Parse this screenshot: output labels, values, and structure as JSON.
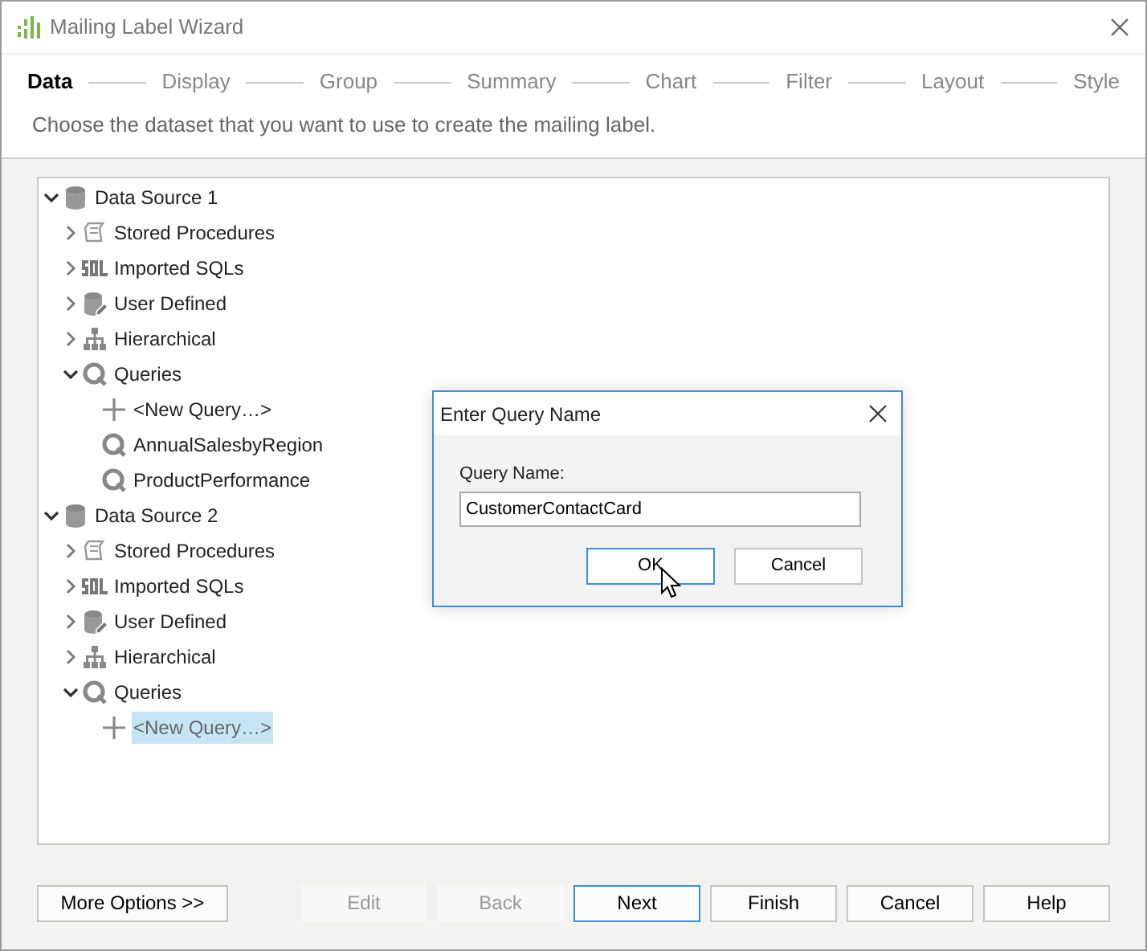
{
  "window": {
    "title": "Mailing Label Wizard"
  },
  "steps": [
    {
      "label": "Data",
      "selected": true
    },
    {
      "label": "Display",
      "selected": false
    },
    {
      "label": "Group",
      "selected": false
    },
    {
      "label": "Summary",
      "selected": false
    },
    {
      "label": "Chart",
      "selected": false
    },
    {
      "label": "Filter",
      "selected": false
    },
    {
      "label": "Layout",
      "selected": false
    },
    {
      "label": "Style",
      "selected": false
    }
  ],
  "instruction": "Choose the dataset that you want to use to create the mailing label.",
  "tree": [
    {
      "kind": "datasource",
      "label": "Data Source 1",
      "expanded": true,
      "selected": false,
      "children": [
        {
          "kind": "procedures",
          "label": "Stored Procedures",
          "expanded": false,
          "selected": false
        },
        {
          "kind": "sql",
          "label": "Imported SQLs",
          "expanded": false,
          "selected": false
        },
        {
          "kind": "userdefined",
          "label": "User Defined",
          "expanded": false,
          "selected": false
        },
        {
          "kind": "hierarchical",
          "label": "Hierarchical",
          "expanded": false,
          "selected": false
        },
        {
          "kind": "queries",
          "label": "Queries",
          "expanded": true,
          "selected": false,
          "children": [
            {
              "kind": "new",
              "label": "<New Query…>",
              "selected": false
            },
            {
              "kind": "query",
              "label": "AnnualSalesbyRegion",
              "selected": false
            },
            {
              "kind": "query",
              "label": "ProductPerformance",
              "selected": false
            }
          ]
        }
      ]
    },
    {
      "kind": "datasource",
      "label": "Data Source 2",
      "expanded": true,
      "selected": false,
      "children": [
        {
          "kind": "procedures",
          "label": "Stored Procedures",
          "expanded": false,
          "selected": false
        },
        {
          "kind": "sql",
          "label": "Imported SQLs",
          "expanded": false,
          "selected": false
        },
        {
          "kind": "userdefined",
          "label": "User Defined",
          "expanded": false,
          "selected": false
        },
        {
          "kind": "hierarchical",
          "label": "Hierarchical",
          "expanded": false,
          "selected": false
        },
        {
          "kind": "queries",
          "label": "Queries",
          "expanded": true,
          "selected": false,
          "children": [
            {
              "kind": "new",
              "label": "<New Query…>",
              "selected": true
            }
          ]
        }
      ]
    }
  ],
  "dialog": {
    "title": "Enter Query Name",
    "field_label": "Query Name:",
    "value": "CustomerContactCard",
    "buttons": [
      {
        "label": "OK",
        "default": true
      },
      {
        "label": "Cancel",
        "default": false
      }
    ]
  },
  "more_options": "More Options >>",
  "buttons": [
    {
      "label": "Edit",
      "disabled": true,
      "default": false
    },
    {
      "label": "Back",
      "disabled": true,
      "default": false
    },
    {
      "label": "Next",
      "disabled": false,
      "default": true
    },
    {
      "label": "Finish",
      "disabled": false,
      "default": false
    },
    {
      "label": "Cancel",
      "disabled": false,
      "default": false
    },
    {
      "label": "Help",
      "disabled": false,
      "default": false
    }
  ]
}
